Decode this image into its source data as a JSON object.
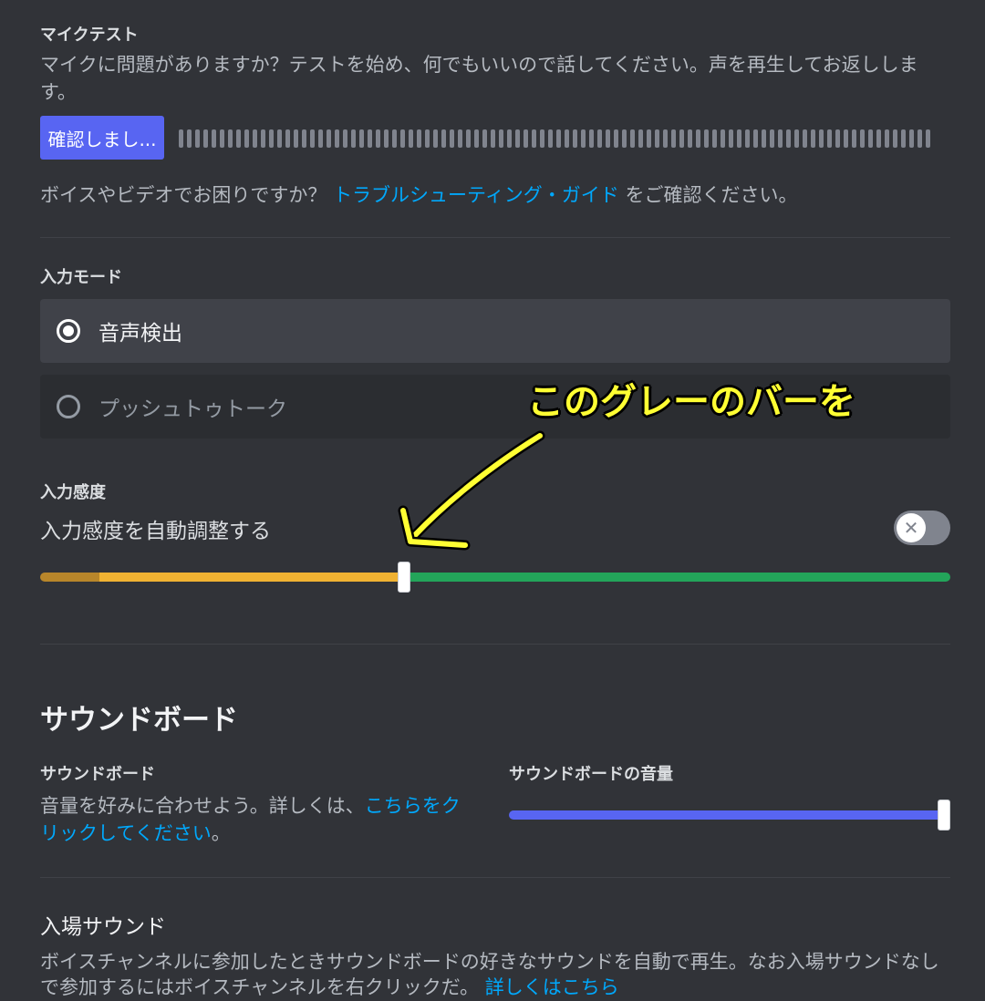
{
  "mic_test": {
    "title": "マイクテスト",
    "description": "マイクに問題がありますか？テストを始め、何でもいいので話してください。声を再生してお返しします。",
    "button_label": "確認しまし...",
    "troubleshoot_prefix": "ボイスやビデオでお困りですか？",
    "troubleshoot_link": "トラブルシューティング・ガイド",
    "troubleshoot_suffix": "をご確認ください。"
  },
  "input_mode": {
    "title": "入力モード",
    "options": [
      {
        "label": "音声検出",
        "selected": true
      },
      {
        "label": "プッシュトゥトーク",
        "selected": false
      }
    ]
  },
  "input_sensitivity": {
    "title": "入力感度",
    "auto_label": "入力感度を自動調整する",
    "auto_enabled": false,
    "threshold_fraction": 0.4,
    "active_level_fraction": 0.065,
    "colors": {
      "active": "#b8862a",
      "below": "#f0b232",
      "above": "#23a55a"
    }
  },
  "annotation": {
    "text": "このグレーのバーを",
    "color": "#ffff33"
  },
  "soundboard": {
    "heading": "サウンドボード",
    "label": "サウンドボード",
    "description_prefix": "音量を好みに合わせよう。詳しくは、",
    "description_link": "こちらをクリックしてください",
    "description_suffix": "。",
    "volume_label": "サウンドボードの音量",
    "volume_fraction": 1.0,
    "volume_color": "#5865f2"
  },
  "entrance_sound": {
    "title": "入場サウンド",
    "description_line1": "ボイスチャンネルに参加したときサウンドボードの好きなサウンドを自動で再生。なお入場サウンドなし",
    "description_line2": "で参加するにはボイスチャンネルを右クリックだ。",
    "link": "詳しくはこちら"
  },
  "icons": {
    "toggle": "close-icon"
  }
}
